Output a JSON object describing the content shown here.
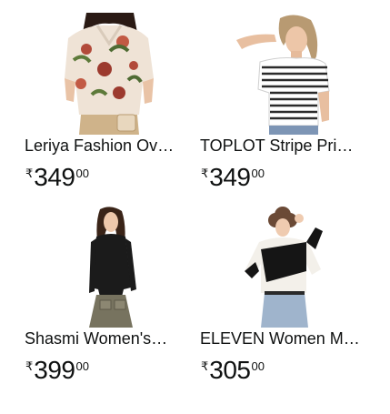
{
  "products": [
    {
      "title": "Leriya Fashion Ov…",
      "currency_symbol": "₹",
      "price_whole": "349",
      "price_fraction": "00",
      "image_icon": "floral-shirt-model-image"
    },
    {
      "title": "TOPLOT Stripe Pri…",
      "currency_symbol": "₹",
      "price_whole": "349",
      "price_fraction": "00",
      "image_icon": "striped-tee-model-image"
    },
    {
      "title": "Shasmi Women's…",
      "currency_symbol": "₹",
      "price_whole": "399",
      "price_fraction": "00",
      "image_icon": "black-top-model-image"
    },
    {
      "title": "ELEVEN Women M…",
      "currency_symbol": "₹",
      "price_whole": "305",
      "price_fraction": "00",
      "image_icon": "colorblock-sweater-model-image"
    }
  ]
}
